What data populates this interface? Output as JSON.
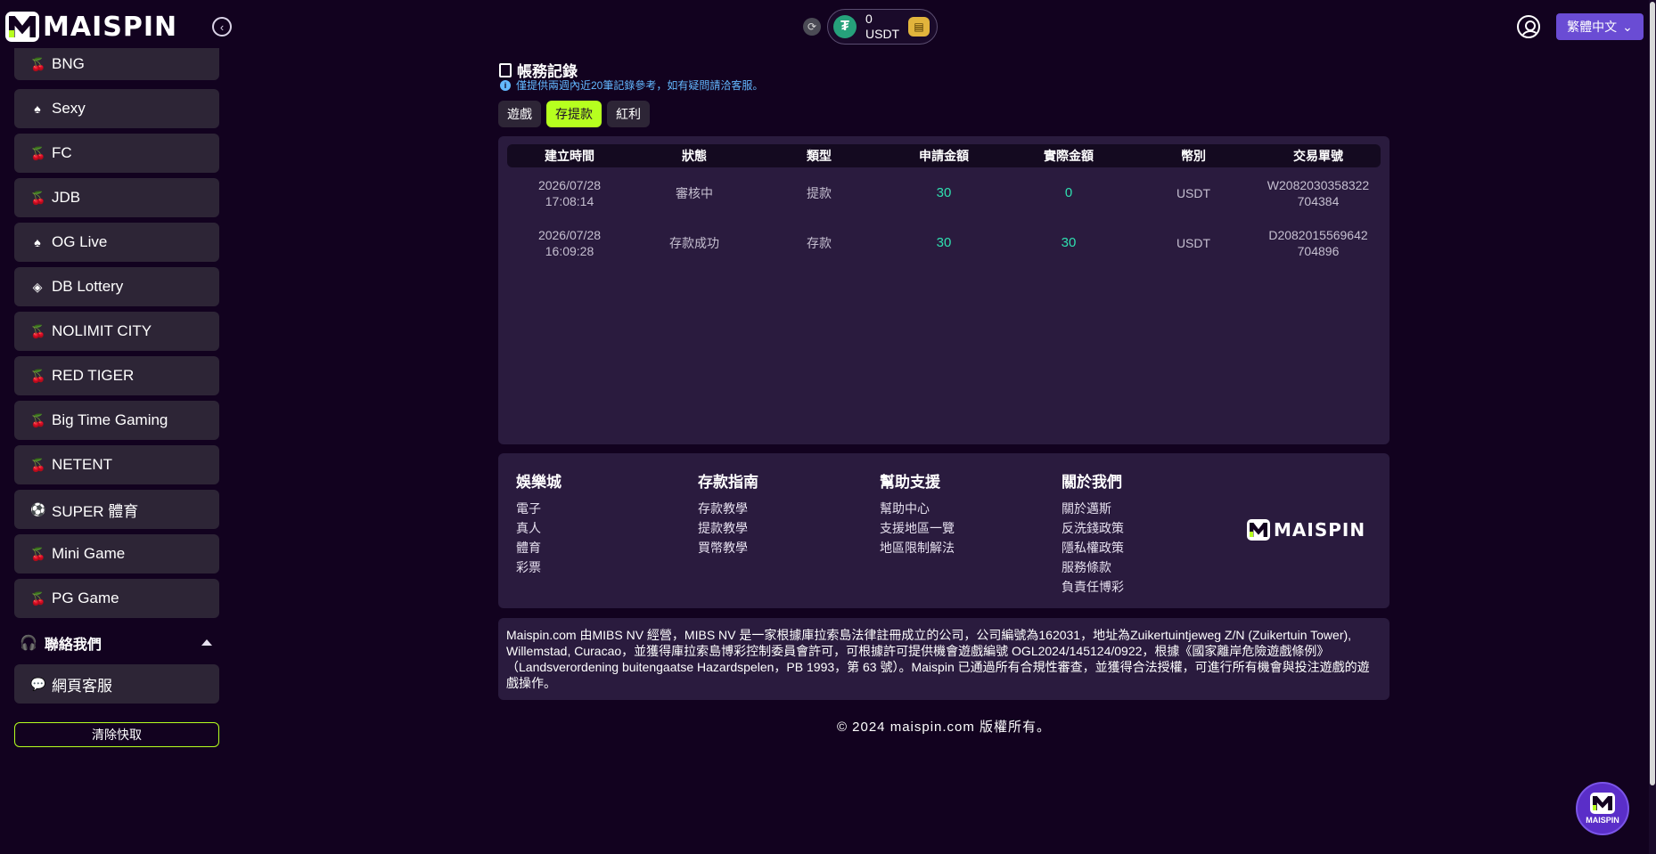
{
  "header": {
    "brand": "MAISPIN",
    "wallet_amount": "0",
    "wallet_currency": "USDT",
    "language": "繁體中文"
  },
  "sidebar": {
    "items": [
      {
        "label": "BNG",
        "icon": "cherry-icon"
      },
      {
        "label": "Sexy",
        "icon": "casino-icon"
      },
      {
        "label": "FC",
        "icon": "cherry-icon"
      },
      {
        "label": "JDB",
        "icon": "cherry-icon"
      },
      {
        "label": "OG Live",
        "icon": "casino-icon"
      },
      {
        "label": "DB Lottery",
        "icon": "lottery-ticket-icon"
      },
      {
        "label": "NOLIMIT CITY",
        "icon": "cherry-icon"
      },
      {
        "label": "RED TIGER",
        "icon": "cherry-icon"
      },
      {
        "label": "Big Time Gaming",
        "icon": "cherry-icon"
      },
      {
        "label": "NETENT",
        "icon": "cherry-icon"
      },
      {
        "label": "SUPER 體育",
        "icon": "soccer-ball-icon"
      },
      {
        "label": "Mini Game",
        "icon": "cherry-icon"
      },
      {
        "label": "PG Game",
        "icon": "cherry-icon"
      }
    ],
    "contact_title": "聯絡我們",
    "contact_items": [
      {
        "label": "網頁客服",
        "icon": "chat-icon"
      }
    ],
    "clear_cache": "清除快取"
  },
  "main": {
    "title": "帳務記錄",
    "notice": "僅提供兩週內近20筆記錄參考，如有疑問請洽客服。",
    "tabs": [
      {
        "label": "遊戲",
        "active": false
      },
      {
        "label": "存提款",
        "active": true
      },
      {
        "label": "紅利",
        "active": false
      }
    ],
    "table": {
      "headers": [
        "建立時間",
        "狀態",
        "類型",
        "申請金額",
        "實際金額",
        "幣別",
        "交易單號"
      ],
      "rows": [
        {
          "date": "2026/07/28",
          "time": "17:08:14",
          "status": "審核中",
          "type": "提款",
          "requested": "30",
          "actual": "0",
          "currency": "USDT",
          "txid": "W2082030358322704384"
        },
        {
          "date": "2026/07/28",
          "time": "16:09:28",
          "status": "存款成功",
          "type": "存款",
          "requested": "30",
          "actual": "30",
          "currency": "USDT",
          "txid": "D2082015569642704896"
        }
      ]
    }
  },
  "footer": {
    "columns": [
      {
        "title": "娛樂城",
        "links": [
          "電子",
          "真人",
          "體育",
          "彩票"
        ]
      },
      {
        "title": "存款指南",
        "links": [
          "存款教學",
          "提款教學",
          "買幣教學"
        ]
      },
      {
        "title": "幫助支援",
        "links": [
          "幫助中心",
          "支援地區一覽",
          "地區限制解法"
        ]
      },
      {
        "title": "關於我們",
        "links": [
          "關於邁斯",
          "反洗錢政策",
          "隱私權政策",
          "服務條款",
          "負責任博彩"
        ]
      }
    ],
    "brand": "MAISPIN",
    "disclaimer": "Maispin.com 由MIBS NV 經營，MIBS NV 是一家根據庫拉索島法律註冊成立的公司，公司編號為162031，地址為Zuikertuintjeweg Z/N (Zuikertuin Tower), Willemstad, Curacao，並獲得庫拉索島博彩控制委員會許可，可根據許可提供機會遊戲編號 OGL2024/145124/0922，根據《國家離岸危險遊戲條例》（Landsverordening buitengaatse Hazardspelen，PB 1993，第 63 號）。Maispin 已通過所有合規性審查，並獲得合法授權，可進行所有機會與投注遊戲的遊戲操作。",
    "copyright": "© 2024 maispin.com 版權所有。"
  },
  "float_button": {
    "label": "MAISPIN"
  },
  "colors": {
    "background": "#12021f",
    "panel": "#2a1b3e",
    "nav_item": "#2d2536",
    "accent_green": "#b6ff1f",
    "amount_teal": "#2fe0b0",
    "language_button": "#6a4cd4",
    "notice_blue": "#63b8ff"
  }
}
